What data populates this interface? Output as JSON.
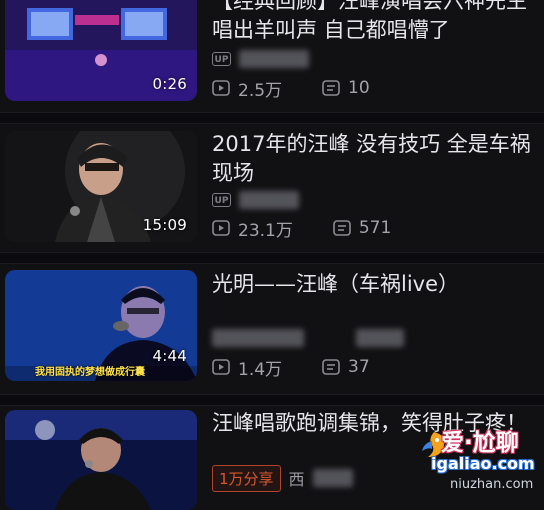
{
  "videos": [
    {
      "title": "【经典回顾】汪峰演唱会六神先生唱出羊叫声  自己都唱懵了",
      "duration": "0:26",
      "uploader_icon": "UP",
      "views": "2.5万",
      "comments": "10"
    },
    {
      "title": "2017年的汪峰  没有技巧  全是车祸现场",
      "duration": "15:09",
      "uploader_icon": "UP",
      "views": "23.1万",
      "comments": "571"
    },
    {
      "title": "光明——汪峰（车祸live）",
      "duration": "4:44",
      "thumb_caption": "我用固执的梦想做成行囊",
      "views": "1.4万",
      "comments": "37"
    },
    {
      "title": "汪峰唱歌跑调集锦，笑得肚子疼！",
      "share_badge": "1万分享",
      "uploader_partial": "西"
    }
  ],
  "watermark": {
    "main": "爱·尬聊",
    "url": "igaliao.com",
    "sub": "niuzhan.com"
  },
  "colors": {
    "background": "#111114",
    "title_text": "#e6e6ea",
    "meta_text": "#8b8b92",
    "badge_orange": "#d3582d"
  }
}
